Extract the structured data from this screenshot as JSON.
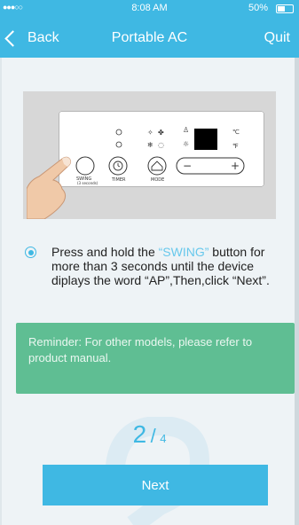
{
  "status_bar": {
    "signal": "●●●○○",
    "time": "8:08 AM",
    "battery": "50%"
  },
  "nav": {
    "back_label": "Back",
    "title": "Portable AC",
    "quit_label": "Quit"
  },
  "illustration": {
    "swing_label": "SWING",
    "swing_sub": "(3 seconds)",
    "timer_label": "TIMER",
    "mode_label": "MODE",
    "minus": "−",
    "plus": "+",
    "unit_c": "℃",
    "unit_f": "℉"
  },
  "instruction": {
    "part1": "Press and hold the ",
    "highlight": "“SWING”",
    "part2": " button for more than 3 seconds until the device diplays the word “AP”,Then,click “Next”."
  },
  "reminder": {
    "text": "Reminder: For other models, please refer to product manual."
  },
  "step": {
    "current": "2",
    "separator": "/",
    "total": "4"
  },
  "next_label": "Next",
  "colors": {
    "primary": "#3fb8e3",
    "reminder_bg": "#5fbe93",
    "page_bg": "#eef3f6"
  }
}
